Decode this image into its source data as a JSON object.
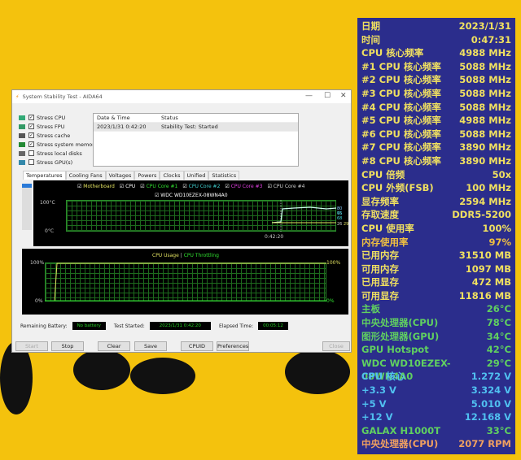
{
  "window": {
    "title": "System Stability Test - AIDA64",
    "minimize": "—",
    "maximize": "☐",
    "close": "✕"
  },
  "stress": [
    {
      "label": "Stress CPU",
      "checked": true
    },
    {
      "label": "Stress FPU",
      "checked": true
    },
    {
      "label": "Stress cache",
      "checked": true
    },
    {
      "label": "Stress system memory",
      "checked": true
    },
    {
      "label": "Stress local disks",
      "checked": false
    },
    {
      "label": "Stress GPU(s)",
      "checked": false
    }
  ],
  "log": {
    "headers": [
      "Date & Time",
      "Status"
    ],
    "rows": [
      [
        "2023/1/31 0:42:20",
        "Stability Test: Started"
      ]
    ]
  },
  "tabs": [
    "Temperatures",
    "Cooling Fans",
    "Voltages",
    "Powers",
    "Clocks",
    "Unified",
    "Statistics"
  ],
  "temp_chart": {
    "legend": [
      {
        "label": "Motherboard",
        "color": "#e0e060"
      },
      {
        "label": "CPU",
        "color": "#ffffff"
      },
      {
        "label": "CPU Core #1",
        "color": "#30e030"
      },
      {
        "label": "CPU Core #2",
        "color": "#40d0d0"
      },
      {
        "label": "CPU Core #3",
        "color": "#e040e0"
      },
      {
        "label": "CPU Core #4",
        "color": "#d0d0d0"
      },
      {
        "label": "WDC WD10EZEX-08WN4A0",
        "color": "#ffffff"
      }
    ],
    "y_top": "100°C",
    "y_bottom": "0°C",
    "x_label": "0:42:20",
    "right_values_top": "80 76",
    "right_values_mid": "65 68",
    "right_values_low": "26",
    "right_values_low2": "29"
  },
  "cpu_chart": {
    "title_usage": "CPU Usage",
    "sep": "|",
    "title_throttle": "CPU Throttling",
    "y_top_left": "100%",
    "y_bottom_left": "0%",
    "y_top_right": "100%",
    "y_bottom_right": "0%"
  },
  "status": {
    "battery_label": "Remaining Battery:",
    "battery": "No battery",
    "started_label": "Test Started:",
    "started": "2023/1/31 0:42:20",
    "elapsed_label": "Elapsed Time:",
    "elapsed": "00:05:12"
  },
  "buttons": {
    "start": "Start",
    "stop": "Stop",
    "clear": "Clear",
    "save": "Save",
    "cpuid": "CPUID",
    "preferences": "Preferences",
    "close": "Close"
  },
  "osd": [
    [
      "日期",
      "2023/1/31",
      "#f0e060"
    ],
    [
      "时间",
      "0:47:31",
      "#f0e060"
    ],
    [
      "CPU 核心频率",
      "4988 MHz",
      "#f0e060"
    ],
    [
      "#1 CPU 核心频率",
      "5088 MHz",
      "#f0e060"
    ],
    [
      "#2 CPU 核心频率",
      "5088 MHz",
      "#f0e060"
    ],
    [
      "#3 CPU 核心频率",
      "5088 MHz",
      "#f0e060"
    ],
    [
      "#4 CPU 核心频率",
      "5088 MHz",
      "#f0e060"
    ],
    [
      "#5 CPU 核心频率",
      "4988 MHz",
      "#f0e060"
    ],
    [
      "#6 CPU 核心频率",
      "5088 MHz",
      "#f0e060"
    ],
    [
      "#7 CPU 核心频率",
      "3890 MHz",
      "#f0e060"
    ],
    [
      "#8 CPU 核心频率",
      "3890 MHz",
      "#f0e060"
    ],
    [
      "CPU 倍频",
      "50x",
      "#f0e060"
    ],
    [
      "CPU 外频(FSB)",
      "100 MHz",
      "#f0e060"
    ],
    [
      "显存频率",
      "2594 MHz",
      "#f0e060"
    ],
    [
      "存取速度",
      "DDR5-5200",
      "#f0e060"
    ],
    [
      "CPU 使用率",
      "100%",
      "#f0e060"
    ],
    [
      "内存使用率",
      "97%",
      "#f0c040"
    ],
    [
      "已用内存",
      "31510 MB",
      "#f0e060"
    ],
    [
      "可用内存",
      "1097 MB",
      "#f0e060"
    ],
    [
      "已用显存",
      "472 MB",
      "#f0e060"
    ],
    [
      "可用显存",
      "11816 MB",
      "#f0e060"
    ],
    [
      "主板",
      "26°C",
      "#60d060"
    ],
    [
      "中央处理器(CPU)",
      "78°C",
      "#60d060"
    ],
    [
      "图形处理器(GPU)",
      "34°C",
      "#60d060"
    ],
    [
      "GPU Hotspot",
      "42°C",
      "#60d060"
    ],
    [
      "WDC WD10EZEX-08WN4A0",
      "29°C",
      "#60d060"
    ],
    [
      "CPU 核心",
      "1.272 V",
      "#50c0f0"
    ],
    [
      "+3.3 V",
      "3.324 V",
      "#50c0f0"
    ],
    [
      "+5 V",
      "5.010 V",
      "#50c0f0"
    ],
    [
      "+12 V",
      "12.168 V",
      "#50c0f0"
    ],
    [
      "GALAX H1000T",
      "33°C",
      "#60d060"
    ],
    [
      "中央处理器(CPU)",
      "2077 RPM",
      "#f0a060"
    ]
  ]
}
